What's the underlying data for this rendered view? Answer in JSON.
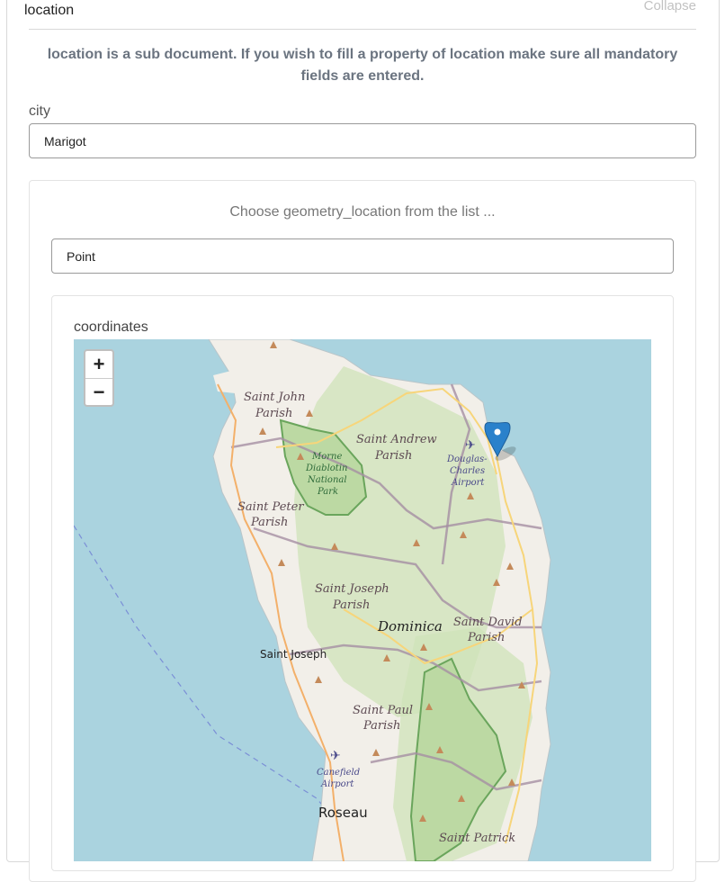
{
  "header": {
    "title": "location",
    "collapse_label": "Collapse"
  },
  "notice": "location is a sub document. If you wish to fill a property of location make sure all mandatory fields are entered.",
  "city": {
    "label": "city",
    "value": "Marigot"
  },
  "geometry": {
    "prompt": "Choose geometry_location from the list ...",
    "selected": "Point"
  },
  "coordinates": {
    "label": "coordinates"
  },
  "map": {
    "zoom_in": "+",
    "zoom_out": "−",
    "marker_icon": "map-pin-icon",
    "places": {
      "saint_john_1": "Saint John",
      "parish_sj": "Parish",
      "saint_andrew": "Saint Andrew",
      "parish_sa": "Parish",
      "morne": "Morne",
      "diablotin": "Diablotin",
      "national": "National",
      "park": "Park",
      "douglas": "Douglas-",
      "charles": "Charles",
      "airport1": "Airport",
      "saint_peter": "Saint Peter",
      "parish_sp": "Parish",
      "saint_joseph_par": "Saint Joseph",
      "parish_sjo": "Parish",
      "dominica": "Dominica",
      "saint_david": "Saint David",
      "parish_sd": "Parish",
      "saint_joseph_town": "Saint Joseph",
      "saint_paul": "Saint Paul",
      "parish_spa": "Parish",
      "canefield": "Canefield",
      "airport2": "Airport",
      "roseau": "Roseau",
      "saint_patrick": "Saint Patrick"
    }
  },
  "colors": {
    "sea": "#aad3df",
    "land": "#f2efe9",
    "park": "#cfe3b8",
    "marker": "#2a81cb"
  }
}
